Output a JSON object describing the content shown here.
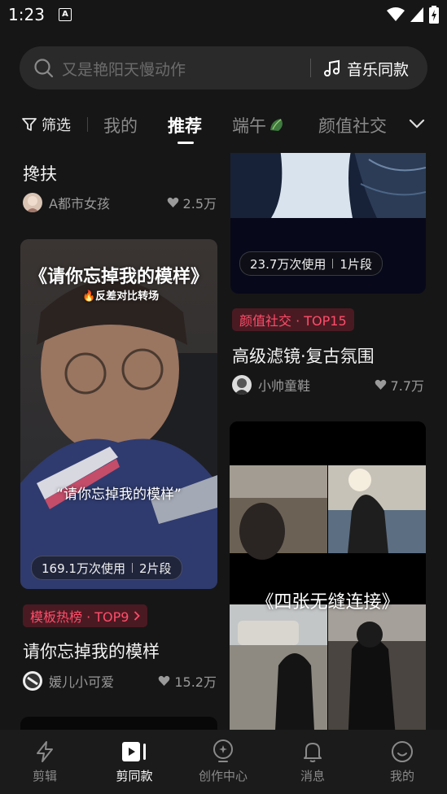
{
  "status_bar": {
    "time": "1:23",
    "notification_letter": "A"
  },
  "search": {
    "placeholder": "又是艳阳天慢动作",
    "music_button": "音乐同款"
  },
  "tabs": {
    "filter_label": "筛选",
    "items": [
      {
        "label": "我的",
        "active": false
      },
      {
        "label": "推荐",
        "active": true
      },
      {
        "label": "端午",
        "active": false
      },
      {
        "label": "颜值社交",
        "active": false
      }
    ]
  },
  "feed": {
    "left": [
      {
        "title": "搀扶",
        "author": "A都市女孩",
        "likes": "2.5万"
      },
      {
        "overlay_title": "《请你忘掉我的模样》",
        "overlay_subtitle": "🔥反差对比转场",
        "overlay_caption": "“请你忘掉我的模样”",
        "usage": "169.1万次使用",
        "segments": "2片段",
        "badge": "模板热榜 · TOP9",
        "title": "请你忘掉我的模样",
        "author": "媛儿小可爱",
        "likes": "15.2万"
      }
    ],
    "right": [
      {
        "usage": "23.7万次使用",
        "segments": "1片段",
        "badge": "颜值社交 · TOP15",
        "title": "高级滤镜·复古氛围",
        "author": "小帅童鞋",
        "likes": "7.7万"
      },
      {
        "overlay_caption": "《四张无缝连接》"
      }
    ]
  },
  "bottom_nav": [
    {
      "label": "剪辑",
      "icon": "lightning-icon",
      "active": false
    },
    {
      "label": "剪同款",
      "icon": "template-play-icon",
      "active": true
    },
    {
      "label": "创作中心",
      "icon": "lightbulb-icon",
      "active": false
    },
    {
      "label": "消息",
      "icon": "bell-icon",
      "active": false
    },
    {
      "label": "我的",
      "icon": "smile-face-icon",
      "active": false
    }
  ],
  "colors": {
    "background": "#161616",
    "badge_text": "#ff4d6a",
    "badge_bg": "#4a1a22"
  }
}
